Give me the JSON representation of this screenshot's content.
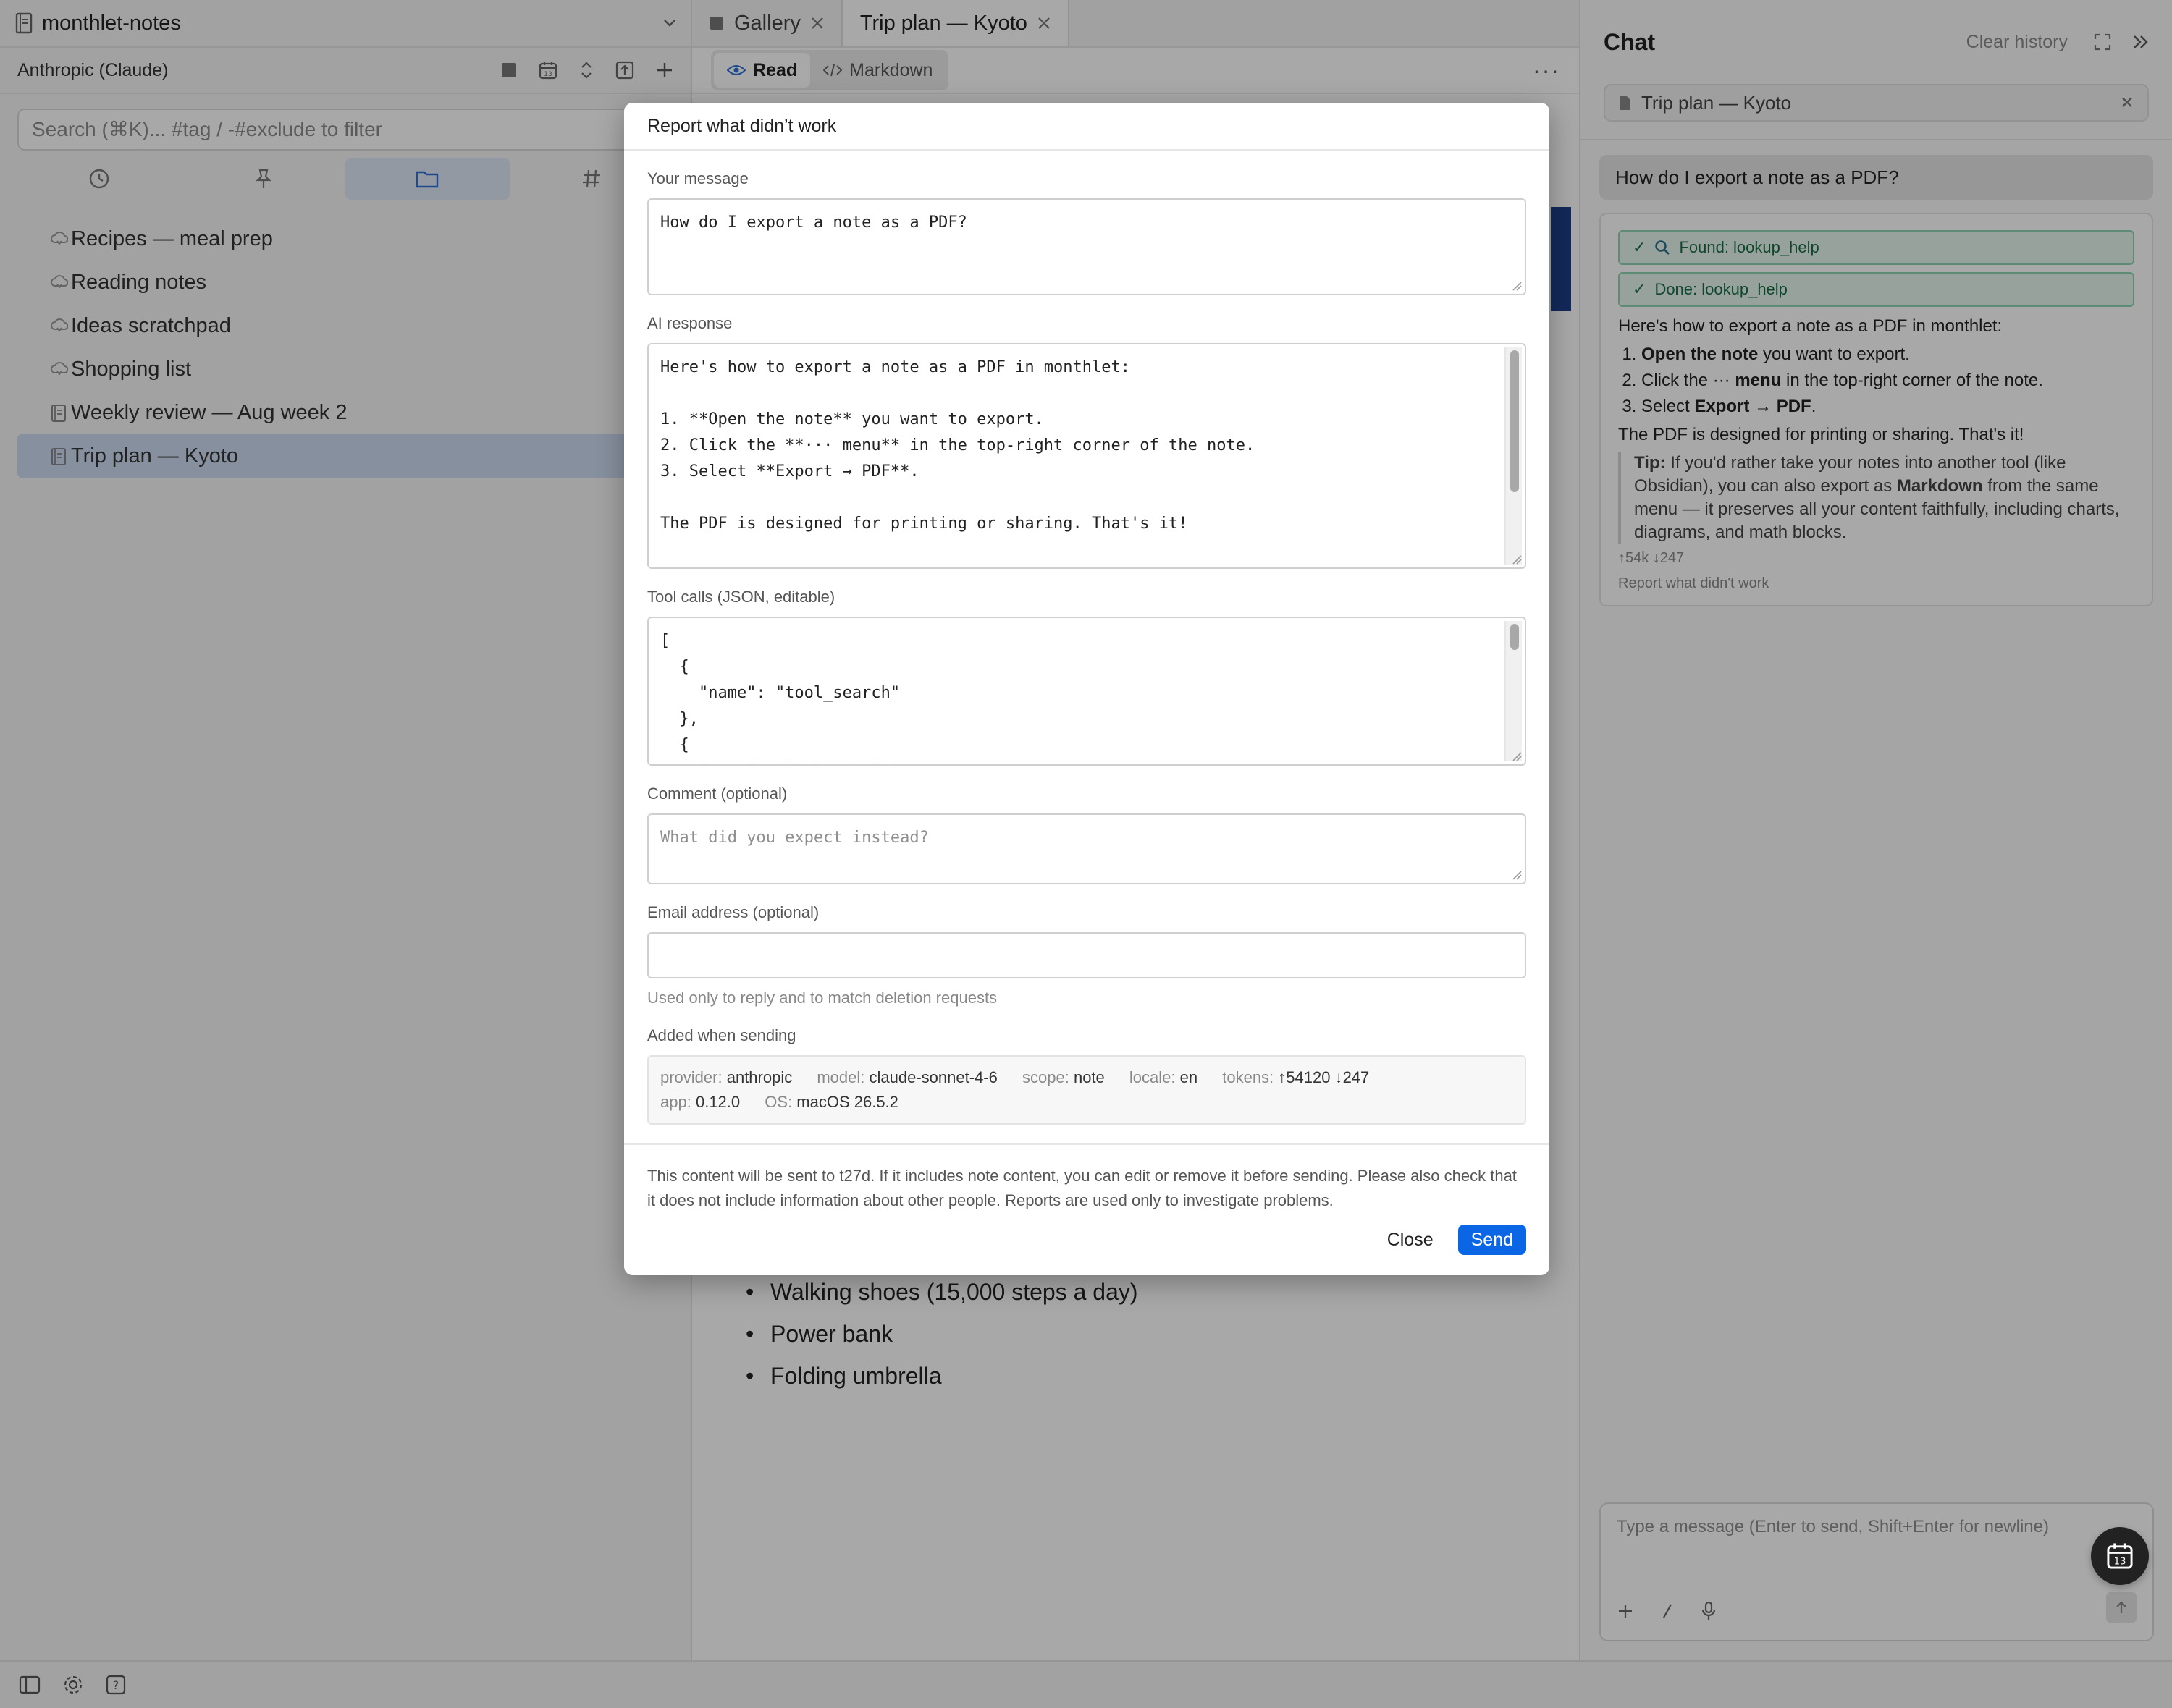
{
  "sidebar": {
    "vault_name": "monthlet-notes",
    "provider": "Anthropic (Claude)",
    "search_placeholder": "Search (⌘K)... #tag / -#exclude to filter",
    "notes": [
      {
        "title": "Recipes — meal prep",
        "kind": "cloud"
      },
      {
        "title": "Reading notes",
        "kind": "cloud"
      },
      {
        "title": "Ideas scratchpad",
        "kind": "cloud"
      },
      {
        "title": "Shopping list",
        "kind": "cloud"
      },
      {
        "title": "Weekly review — Aug week 2",
        "kind": "doc"
      },
      {
        "title": "Trip plan — Kyoto",
        "kind": "doc",
        "active": true
      }
    ]
  },
  "editor": {
    "tabs": [
      {
        "label": "Gallery"
      },
      {
        "label": "Trip plan — Kyoto",
        "active": true
      }
    ],
    "mode_read": "Read",
    "mode_markdown": "Markdown",
    "list_items": [
      "Walking shoes (15,000 steps a day)",
      "Power bank",
      "Folding umbrella"
    ],
    "accent_color": "#1e3f8a"
  },
  "chat": {
    "title": "Chat",
    "clear_history": "Clear history",
    "context_note": "Trip plan — Kyoto",
    "user_message": "How do I export a note as a PDF?",
    "tool_found": "Found: lookup_help",
    "tool_done": "Done: lookup_help",
    "intro": "Here's how to export a note as a PDF in monthlet:",
    "step1_bold": "Open the note",
    "step1_rest": " you want to export.",
    "step2_pre": "Click the ··· ",
    "step2_bold": "menu",
    "step2_rest": " in the top-right corner of the note.",
    "step3_pre": "Select ",
    "step3_bold": "Export → PDF",
    "step3_rest": ".",
    "summary": "The PDF is designed for printing or sharing. That's it!",
    "tip_label": "Tip:",
    "tip_pre": " If you'd rather take your notes into another tool (like Obsidian), you can also export as ",
    "tip_bold": "Markdown",
    "tip_rest": " from the same menu — it preserves all your content faithfully, including charts, diagrams, and math blocks.",
    "tokens": "↑54k ↓247",
    "report_link": "Report what didn't work",
    "composer_placeholder": "Type a message (Enter to send, Shift+Enter for newline)"
  },
  "dialog": {
    "title": "Report what didn’t work",
    "message_label": "Your message",
    "message_value": "How do I export a note as a PDF?",
    "ai_label": "AI response",
    "ai_value": "Here's how to export a note as a PDF in monthlet:\n\n1. **Open the note** you want to export.\n2. Click the **··· menu** in the top-right corner of the note.\n3. Select **Export → PDF**.\n\nThe PDF is designed for printing or sharing. That's it!\n\n> **Tip:** If you'd rather take your notes into another tool (like Obsidian), you can",
    "tools_label": "Tool calls (JSON, editable)",
    "tools_value": "[\n  {\n    \"name\": \"tool_search\"\n  },\n  {\n    \"name\": \"lookup_help\"",
    "comment_label": "Comment (optional)",
    "comment_placeholder": "What did you expect instead?",
    "email_label": "Email address (optional)",
    "email_hint": "Used only to reply and to match deletion requests",
    "added_label": "Added when sending",
    "meta": {
      "provider_k": "provider:",
      "provider_v": "anthropic",
      "model_k": "model:",
      "model_v": "claude-sonnet-4-6",
      "scope_k": "scope:",
      "scope_v": "note",
      "locale_k": "locale:",
      "locale_v": "en",
      "tokens_k": "tokens:",
      "tokens_v": "↑54120 ↓247",
      "app_k": "app:",
      "app_v": "0.12.0",
      "os_k": "OS:",
      "os_v": "macOS 26.5.2"
    },
    "footer_note": "This content will be sent to t27d. If it includes note content, you can edit or remove it before sending. Please also check that it does not include information about other people. Reports are used only to investigate problems.",
    "close_label": "Close",
    "send_label": "Send",
    "send_color": "#0a66e5"
  }
}
